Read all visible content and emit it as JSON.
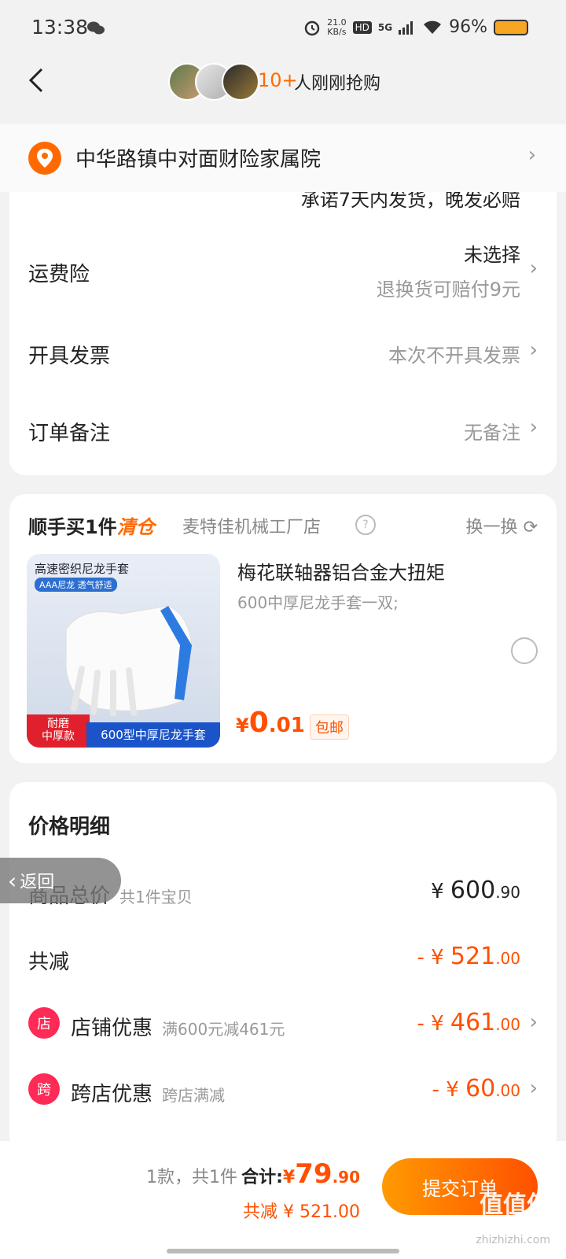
{
  "status": {
    "time": "13:38",
    "speed_top": "21.0",
    "speed_bottom": "KB/s",
    "hd": "HD",
    "net": "5G",
    "battery": "96%"
  },
  "header": {
    "count": "10+",
    "text": "人刚刚抢购"
  },
  "address": {
    "text": "中华路镇中对面财险家属院"
  },
  "service": {
    "promise": "承诺7天内发货，晚发必赔",
    "rows": [
      {
        "label": "运费险",
        "value": "未选择",
        "value2": "退换货可赔付9元"
      },
      {
        "label": "开具发票",
        "value": "本次不开具发票"
      },
      {
        "label": "订单备注",
        "value": "无备注"
      }
    ]
  },
  "upsell": {
    "title": "顺手买1件",
    "tag": "清仓",
    "shop": "麦特佳机械工厂店",
    "swap": "换一换",
    "image_texts": {
      "top": "高速密织尼龙手套",
      "sub": "AAA尼龙  透气舒适",
      "badge_a": "耐磨",
      "badge_b": "中厚款",
      "badge_c": "600型中厚尼龙手套"
    },
    "product_title": "梅花联轴器铝合金大扭矩",
    "product_sub": "600中厚尼龙手套一双;",
    "price_sym": "¥",
    "price_int": "0",
    "price_dec": ".01",
    "free_ship": "包邮"
  },
  "price_detail": {
    "title": "价格明细",
    "goods_label": "商品总价",
    "goods_sub": "共1件宝贝",
    "goods_sym": "¥ ",
    "goods_int": "600",
    "goods_dec": ".90",
    "reduce_label": "共减",
    "reduce_prefix": "- ¥ ",
    "reduce_int": "521",
    "reduce_dec": ".00",
    "shop_icon": "店",
    "shop_label": "店铺优惠",
    "shop_sub": "满600元减461元",
    "shop_prefix": "- ¥ ",
    "shop_int": "461",
    "shop_dec": ".00",
    "cross_icon": "跨",
    "cross_label": "跨店优惠",
    "cross_sub": "跨店满减",
    "cross_prefix": "- ¥ ",
    "cross_int": "60",
    "cross_dec": ".00"
  },
  "return_btn": "返回",
  "bottom": {
    "count": "1款，共1件",
    "total_label": "合计:",
    "total_sym": "¥",
    "total_int": "79",
    "total_dec": ".90",
    "reduce_line": "共减 ¥ 521.00",
    "submit": "提交订单"
  },
  "watermark": {
    "text": "值值值",
    "sub": "zhizhizhi.com"
  },
  "colors": {
    "accent": "#ff5000",
    "orange": "#ff6a00",
    "discount": "#ff2a55"
  }
}
